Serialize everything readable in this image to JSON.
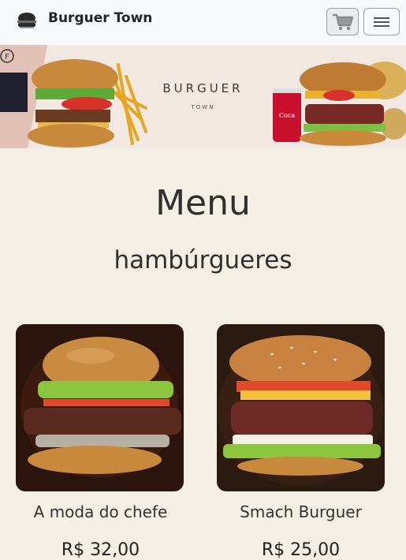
{
  "navbar": {
    "brand_name": "Burguer Town",
    "cart_icon": "cart-icon",
    "menu_icon": "hamburger-menu-icon"
  },
  "banner": {
    "title": "BURGUER",
    "subtitle": "TOWN"
  },
  "page": {
    "title": "Menu",
    "section": "hambúrgueres"
  },
  "products": [
    {
      "name": "A moda do chefe",
      "price": "R$ 32,00"
    },
    {
      "name": "Smach Burguer",
      "price": "R$ 25,00"
    }
  ],
  "colors": {
    "background": "#f3efe4",
    "navbar": "#f8f9fa",
    "text": "#2f2f2f"
  }
}
